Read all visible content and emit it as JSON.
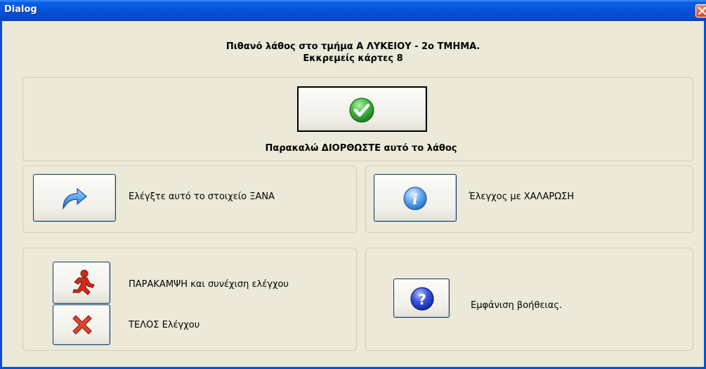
{
  "window": {
    "title": "Dialog"
  },
  "header": {
    "line1": "Πιθανό λάθος στο τμήμα Α ΛΥΚΕΙΟΥ - 2ο ΤΜΗΜΑ.",
    "line2": "Εκκρεμείς κάρτες 8"
  },
  "fix": {
    "label": "Παρακαλώ ΔΙΟΡΘΩΣΤΕ αυτό το λάθος",
    "icon": "checkmark-icon"
  },
  "recheck": {
    "label": "Ελέγξτε αυτό το στοιχείο ΞΑΝΑ",
    "icon": "redo-arrow-icon"
  },
  "relaxed": {
    "label": "Έλεγχος με ΧΑΛΑΡΩΣΗ",
    "icon": "info-icon"
  },
  "skip": {
    "label": "ΠΑΡΑΚΑΜΨΗ και συνέχιση ελέγχου",
    "icon": "running-man-icon"
  },
  "end": {
    "label": "ΤΕΛΟΣ Ελέγχου",
    "icon": "red-x-icon"
  },
  "help": {
    "label": "Εμφάνιση βοήθειας.",
    "icon": "question-icon"
  },
  "colors": {
    "titlebar": "#0553d8",
    "background": "#ece9d8",
    "check_green": "#3cb043",
    "info_blue": "#3a7bd5",
    "help_blue": "#2a3fc8",
    "red": "#d42a1a"
  }
}
